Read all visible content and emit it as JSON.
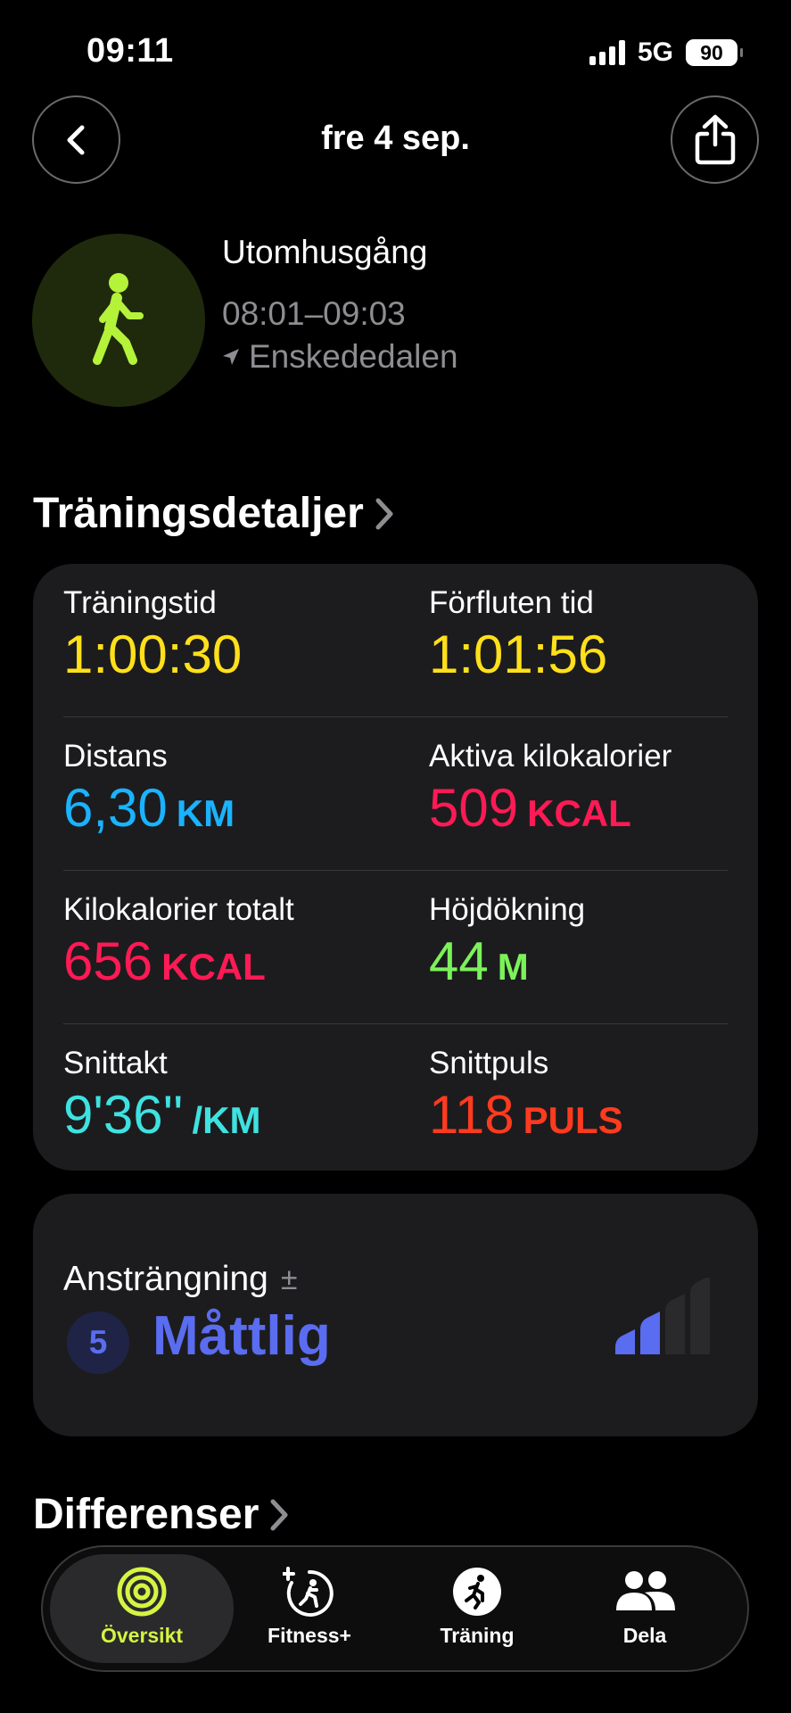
{
  "status_bar": {
    "time": "09:11",
    "network": "5G",
    "battery": "90"
  },
  "nav": {
    "title": "fre 4 sep."
  },
  "workout": {
    "name": "Utomhusgång",
    "time_range": "08:01–09:03",
    "location": "Enskededalen"
  },
  "details": {
    "title": "Träningsdetaljer",
    "rows": [
      [
        {
          "label": "Träningstid",
          "value": "1:00:30",
          "unit": "",
          "color": "#ffe01a"
        },
        {
          "label": "Förfluten tid",
          "value": "1:01:56",
          "unit": "",
          "color": "#ffe01a"
        }
      ],
      [
        {
          "label": "Distans",
          "value": "6,30",
          "unit": "KM",
          "color": "#1ab3ff"
        },
        {
          "label": "Aktiva kilokalorier",
          "value": "509",
          "unit": "KCAL",
          "color": "#ff1a55"
        }
      ],
      [
        {
          "label": "Kilokalorier totalt",
          "value": "656",
          "unit": "KCAL",
          "color": "#ff1a55"
        },
        {
          "label": "Höjdökning",
          "value": "44",
          "unit": "M",
          "color": "#7cf25a"
        }
      ],
      [
        {
          "label": "Snittakt",
          "value": "9'36''",
          "unit": "/KM",
          "color": "#3ee2e0"
        },
        {
          "label": "Snittpuls",
          "value": "118",
          "unit": "PULS",
          "color": "#ff3b1f"
        }
      ]
    ]
  },
  "effort": {
    "label": "Ansträngning",
    "plus_minus": "±",
    "level": "5",
    "value": "Måttlig",
    "color": "#5a6cf0",
    "bars_filled": 2,
    "bars_total": 4
  },
  "differences": {
    "title": "Differenser"
  },
  "tabbar": {
    "tabs": [
      {
        "label": "Översikt",
        "icon": "activity-rings-icon",
        "active": true,
        "color": "#d4f542"
      },
      {
        "label": "Fitness+",
        "icon": "fitness-plus-icon",
        "active": false,
        "color": "#ffffff"
      },
      {
        "label": "Träning",
        "icon": "running-figure-icon",
        "active": false,
        "color": "#ffffff"
      },
      {
        "label": "Dela",
        "icon": "people-icon",
        "active": false,
        "color": "#ffffff"
      }
    ]
  }
}
